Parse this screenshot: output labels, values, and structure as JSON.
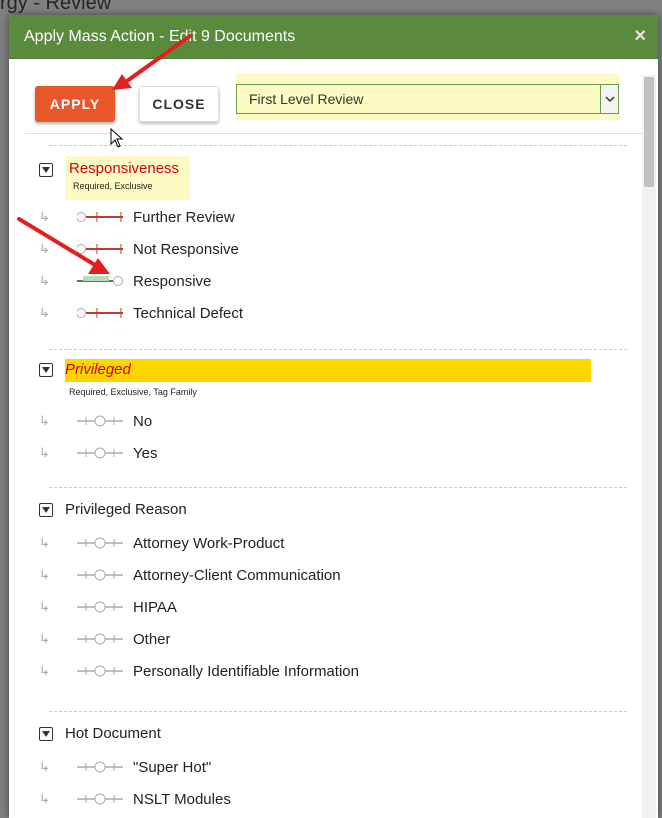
{
  "background": {
    "title": "rgy - Review"
  },
  "modal": {
    "title": "Apply Mass Action - Edit 9 Documents",
    "close_glyph": "×",
    "header_color": "#5a8a3c"
  },
  "toolbar": {
    "apply_label": "APPLY",
    "close_label": "CLOSE",
    "select_value": "First Level Review"
  },
  "sections": {
    "responsiveness": {
      "title": "Responsiveness",
      "subtitle": "Required, Exclusive",
      "options": [
        "Further Review",
        "Not Responsive",
        "Responsive",
        "Technical Defect"
      ],
      "selected": "Responsive"
    },
    "privileged": {
      "title": "Privileged",
      "subtitle": "Required, Exclusive, Tag Family",
      "options": [
        "No",
        "Yes"
      ]
    },
    "privileged_reason": {
      "title": "Privileged Reason",
      "options": [
        "Attorney Work-Product",
        "Attorney-Client Communication",
        "HIPAA",
        "Other",
        "Personally Identifiable Information"
      ]
    },
    "hot_document": {
      "title": "Hot Document",
      "options": [
        "\"Super Hot\"",
        "NSLT Modules"
      ]
    }
  },
  "colors": {
    "apply": "#e8562a",
    "responsive_highlight": "#fbfbc3",
    "privileged_highlight": "#fdd600",
    "required_red": "#d0021b",
    "switch_green": "#3e8e3e",
    "switch_red": "#c0392b"
  }
}
